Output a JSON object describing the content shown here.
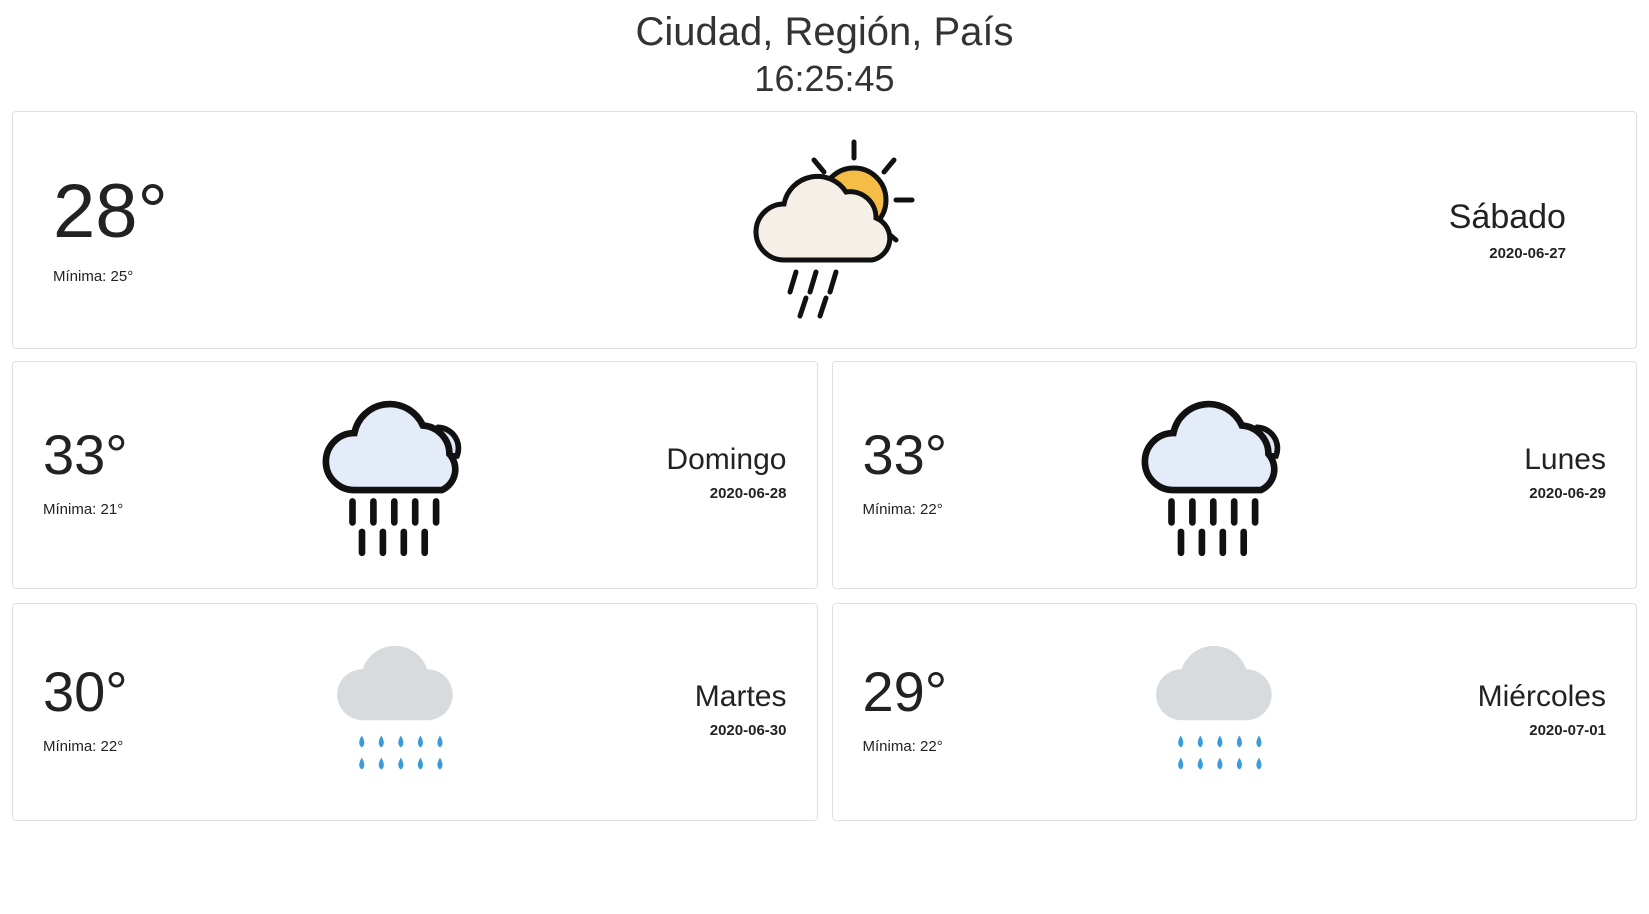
{
  "header": {
    "location": "Ciudad, Región, País",
    "time": "16:25:45"
  },
  "labels": {
    "min_prefix": "Mínima: "
  },
  "today": {
    "temp": "28°",
    "min": "25°",
    "day": "Sábado",
    "date": "2020-06-27",
    "icon": "partly-cloudy-rain"
  },
  "forecast": [
    {
      "temp": "33°",
      "min": "21°",
      "day": "Domingo",
      "date": "2020-06-28",
      "icon": "heavy-rain"
    },
    {
      "temp": "33°",
      "min": "22°",
      "day": "Lunes",
      "date": "2020-06-29",
      "icon": "heavy-rain"
    },
    {
      "temp": "30°",
      "min": "22°",
      "day": "Martes",
      "date": "2020-06-30",
      "icon": "rain-drops"
    },
    {
      "temp": "29°",
      "min": "22°",
      "day": "Miércoles",
      "date": "2020-07-01",
      "icon": "rain-drops"
    }
  ]
}
